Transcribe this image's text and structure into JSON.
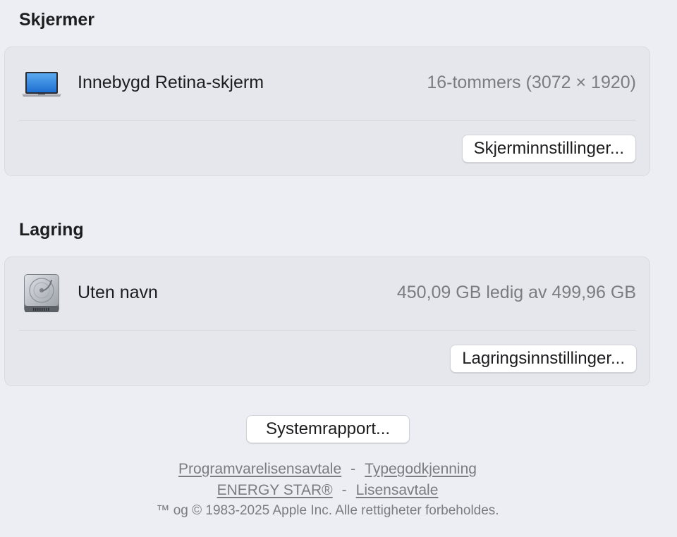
{
  "displays": {
    "title": "Skjermer",
    "item": {
      "icon": "laptop-icon",
      "name": "Innebygd Retina-skjerm",
      "detail": "16-tommers (3072 × 1920)"
    },
    "settings_button": "Skjerminnstillinger..."
  },
  "storage": {
    "title": "Lagring",
    "item": {
      "icon": "hard-drive-icon",
      "name": "Uten navn",
      "detail": "450,09 GB ledig av 499,96 GB"
    },
    "settings_button": "Lagringsinnstillinger..."
  },
  "system_report_button": "Systemrapport...",
  "footer": {
    "link_software_license": "Programvarelisensavtale",
    "link_type_approval": "Typegodkjenning",
    "link_energy_star": "ENERGY STAR®",
    "link_license": "Lisensavtale",
    "separator": "-",
    "copyright": "™ og © 1983-2025 Apple Inc. Alle rettigheter forbeholdes."
  },
  "colors": {
    "background": "#eceef3",
    "panel": "#e6e7ec",
    "secondary_text": "#7c7c80"
  }
}
